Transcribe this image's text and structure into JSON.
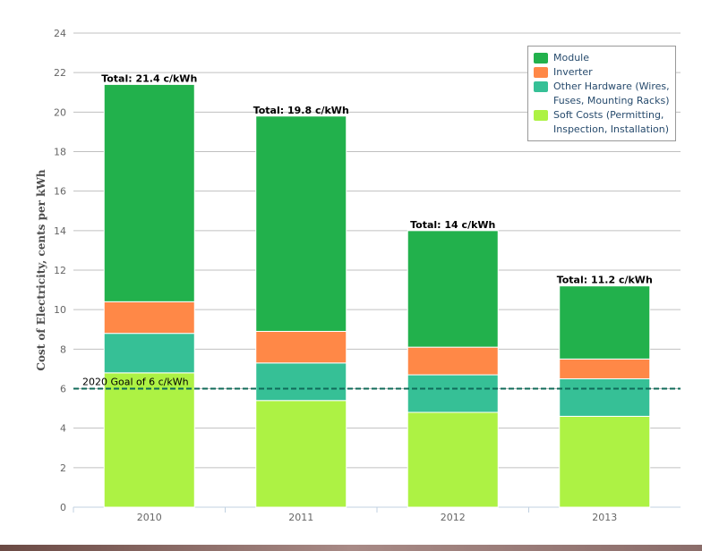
{
  "chart_data": {
    "type": "bar",
    "stacked": true,
    "categories": [
      "2010",
      "2011",
      "2012",
      "2013"
    ],
    "series": [
      {
        "name": "Soft Costs (Permitting, Inspection, Installation)",
        "color": "#adf244",
        "values": [
          6.8,
          5.4,
          4.8,
          4.6
        ]
      },
      {
        "name": "Other Hardware (Wires, Fuses, Mounting Racks)",
        "color": "#36c096",
        "values": [
          2.0,
          1.9,
          1.9,
          1.9
        ]
      },
      {
        "name": "Inverter",
        "color": "#ff8847",
        "values": [
          1.6,
          1.6,
          1.4,
          1.0
        ]
      },
      {
        "name": "Module",
        "color": "#22b14c",
        "values": [
          11.0,
          10.9,
          5.9,
          3.7
        ]
      }
    ],
    "totals": [
      "Total: 21.4 c/kWh",
      "Total: 19.8 c/kWh",
      "Total: 14 c/kWh",
      "Total: 11.2 c/kWh"
    ],
    "legend_order": [
      "Module",
      "Inverter",
      "Other Hardware (Wires, Fuses, Mounting Racks)",
      "Soft Costs (Permitting, Inspection, Installation)"
    ],
    "ylabel": "Cost of Electricity, cents per kWh",
    "xlabel": "",
    "ylim": [
      0,
      24
    ],
    "yticks": [
      0,
      2,
      4,
      6,
      8,
      10,
      12,
      14,
      16,
      18,
      20,
      22,
      24
    ],
    "goal": {
      "value": 6,
      "label": "2020 Goal of 6 c/kWh",
      "color": "#106b5a"
    },
    "grid": true,
    "legend_position": "top-right"
  }
}
